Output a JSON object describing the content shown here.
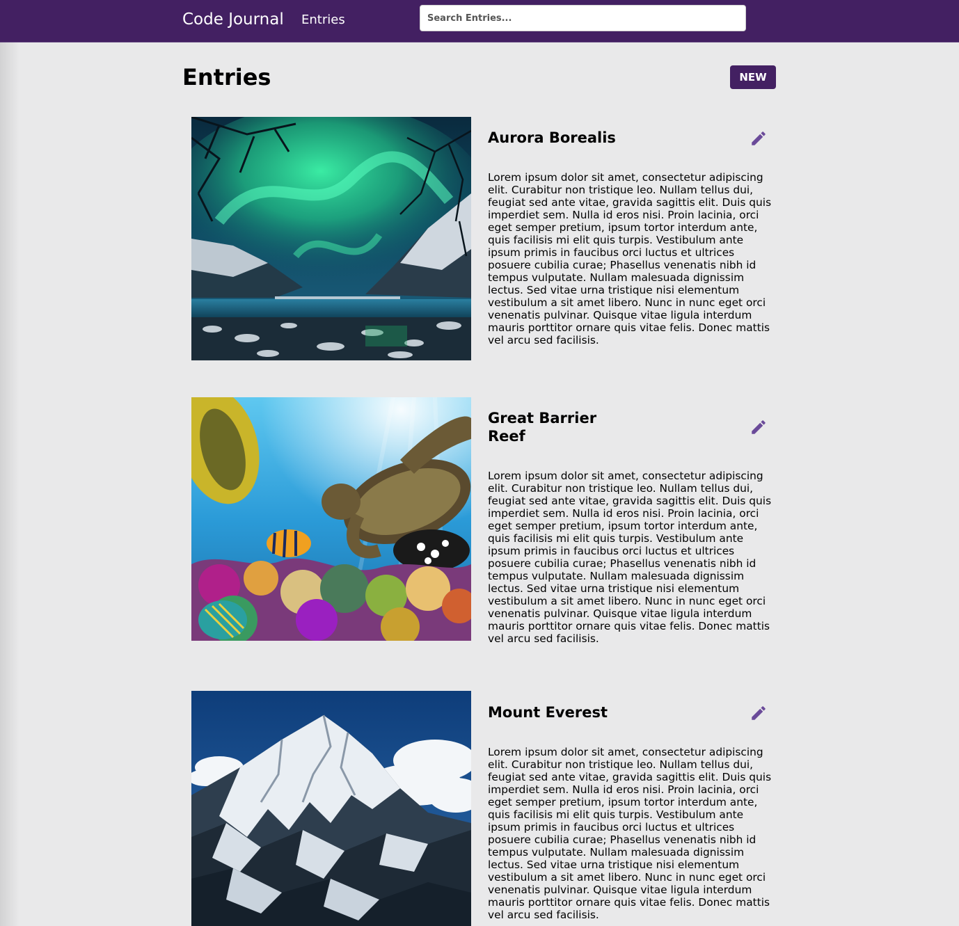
{
  "navbar": {
    "brand": "Code Journal",
    "link_entries": "Entries",
    "search_placeholder": "Search Entries..."
  },
  "header": {
    "title": "Entries",
    "new_button": "NEW"
  },
  "colors": {
    "primary": "#432062",
    "edit_icon": "#6a4a99",
    "background": "#e9e9ea"
  },
  "entries": [
    {
      "title": "Aurora Borealis",
      "image": "aurora-borealis-photo",
      "body": "Lorem ipsum dolor sit amet, consectetur adipiscing elit. Curabitur non tristique leo. Nullam tellus dui, feugiat sed ante vitae, gravida sagittis elit. Duis quis imperdiet sem. Nulla id eros nisi. Proin lacinia, orci eget semper pretium, ipsum tortor interdum ante, quis facilisis mi elit quis turpis. Vestibulum ante ipsum primis in faucibus orci luctus et ultrices posuere cubilia curae; Phasellus venenatis nibh id tempus vulputate. Nullam malesuada dignissim lectus. Sed vitae urna tristique nisi elementum vestibulum a sit amet libero. Nunc in nunc eget orci venenatis pulvinar. Quisque vitae ligula interdum mauris porttitor ornare quis vitae felis. Donec mattis vel arcu sed facilisis."
    },
    {
      "title": "Great Barrier Reef",
      "image": "great-barrier-reef-photo",
      "body": "Lorem ipsum dolor sit amet, consectetur adipiscing elit. Curabitur non tristique leo. Nullam tellus dui, feugiat sed ante vitae, gravida sagittis elit. Duis quis imperdiet sem. Nulla id eros nisi. Proin lacinia, orci eget semper pretium, ipsum tortor interdum ante, quis facilisis mi elit quis turpis. Vestibulum ante ipsum primis in faucibus orci luctus et ultrices posuere cubilia curae; Phasellus venenatis nibh id tempus vulputate. Nullam malesuada dignissim lectus. Sed vitae urna tristique nisi elementum vestibulum a sit amet libero. Nunc in nunc eget orci venenatis pulvinar. Quisque vitae ligula interdum mauris porttitor ornare quis vitae felis. Donec mattis vel arcu sed facilisis."
    },
    {
      "title": "Mount Everest",
      "image": "mount-everest-photo",
      "body": "Lorem ipsum dolor sit amet, consectetur adipiscing elit. Curabitur non tristique leo. Nullam tellus dui, feugiat sed ante vitae, gravida sagittis elit. Duis quis imperdiet sem. Nulla id eros nisi. Proin lacinia, orci eget semper pretium, ipsum tortor interdum ante, quis facilisis mi elit quis turpis. Vestibulum ante ipsum primis in faucibus orci luctus et ultrices posuere cubilia curae; Phasellus venenatis nibh id tempus vulputate. Nullam malesuada dignissim lectus. Sed vitae urna tristique nisi elementum vestibulum a sit amet libero. Nunc in nunc eget orci venenatis pulvinar. Quisque vitae ligula interdum mauris porttitor ornare quis vitae felis. Donec mattis vel arcu sed facilisis."
    }
  ]
}
